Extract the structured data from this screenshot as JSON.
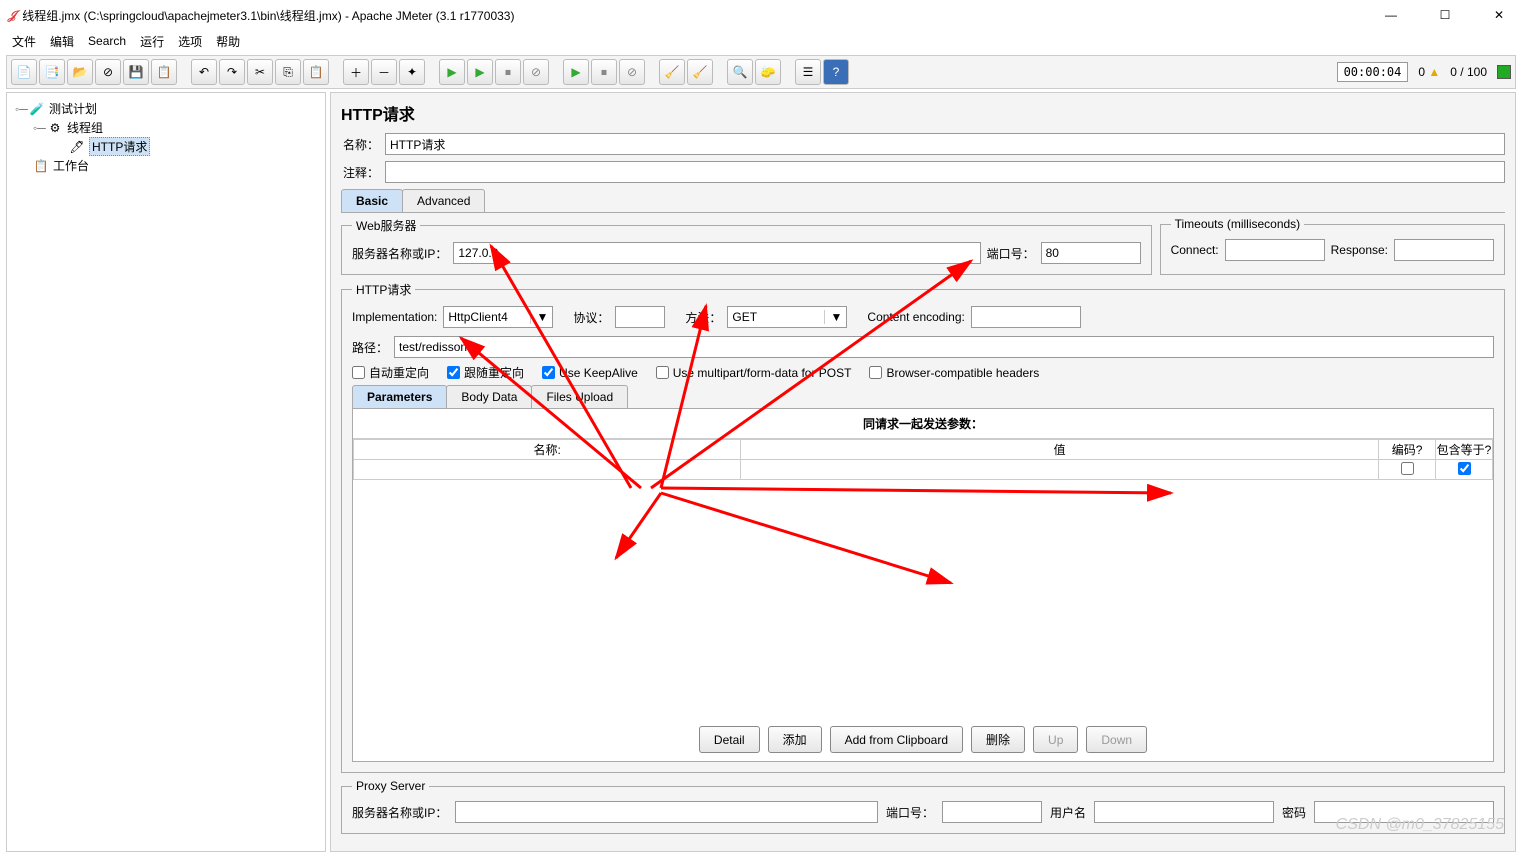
{
  "window": {
    "title": "线程组.jmx (C:\\springcloud\\apachejmeter3.1\\bin\\线程组.jmx) - Apache JMeter (3.1 r1770033)"
  },
  "menu": {
    "file": "文件",
    "edit": "编辑",
    "search": "Search",
    "run": "运行",
    "options": "选项",
    "help": "帮助"
  },
  "status": {
    "timer": "00:00:04",
    "count1": "0",
    "threads": "0 / 100",
    "errors": "0"
  },
  "tree": {
    "testplan": "测试计划",
    "threadgroup": "线程组",
    "httpreq": "HTTP请求",
    "workbench": "工作台"
  },
  "editor": {
    "header": "HTTP请求",
    "name_label": "名称：",
    "name_value": "HTTP请求",
    "comment_label": "注释：",
    "comment_value": "",
    "tab_basic": "Basic",
    "tab_advanced": "Advanced"
  },
  "web": {
    "legend": "Web服务器",
    "server_label": "服务器名称或IP：",
    "server_value": "127.0.0",
    "port_label": "端口号：",
    "port_value": "80",
    "timeouts_legend": "Timeouts (milliseconds)",
    "connect_label": "Connect:",
    "connect_value": "",
    "response_label": "Response:",
    "response_value": ""
  },
  "http": {
    "legend": "HTTP请求",
    "impl_label": "Implementation:",
    "impl_value": "HttpClient4",
    "proto_label": "协议：",
    "proto_value": "",
    "method_label": "方法：",
    "method_value": "GET",
    "enc_label": "Content encoding:",
    "enc_value": "",
    "path_label": "路径：",
    "path_value": "test/redisson",
    "cb_autoredirect": "自动重定向",
    "cb_followredirect": "跟随重定向",
    "cb_keepalive": "Use KeepAlive",
    "cb_multipart": "Use multipart/form-data for POST",
    "cb_browser": "Browser-compatible headers",
    "subtab_params": "Parameters",
    "subtab_body": "Body Data",
    "subtab_files": "Files Upload",
    "params_title": "同请求一起发送参数：",
    "col_name": "名称:",
    "col_value": "值",
    "col_encode": "编码?",
    "col_include": "包含等于?",
    "btn_detail": "Detail",
    "btn_add": "添加",
    "btn_clipboard": "Add from Clipboard",
    "btn_delete": "删除",
    "btn_up": "Up",
    "btn_down": "Down"
  },
  "proxy": {
    "legend": "Proxy Server",
    "server_label": "服务器名称或IP：",
    "server_value": "",
    "port_label": "端口号：",
    "port_value": "",
    "user_label": "用户名",
    "user_value": "",
    "pass_label": "密码",
    "pass_value": ""
  },
  "watermark": "CSDN @m0_37825155"
}
